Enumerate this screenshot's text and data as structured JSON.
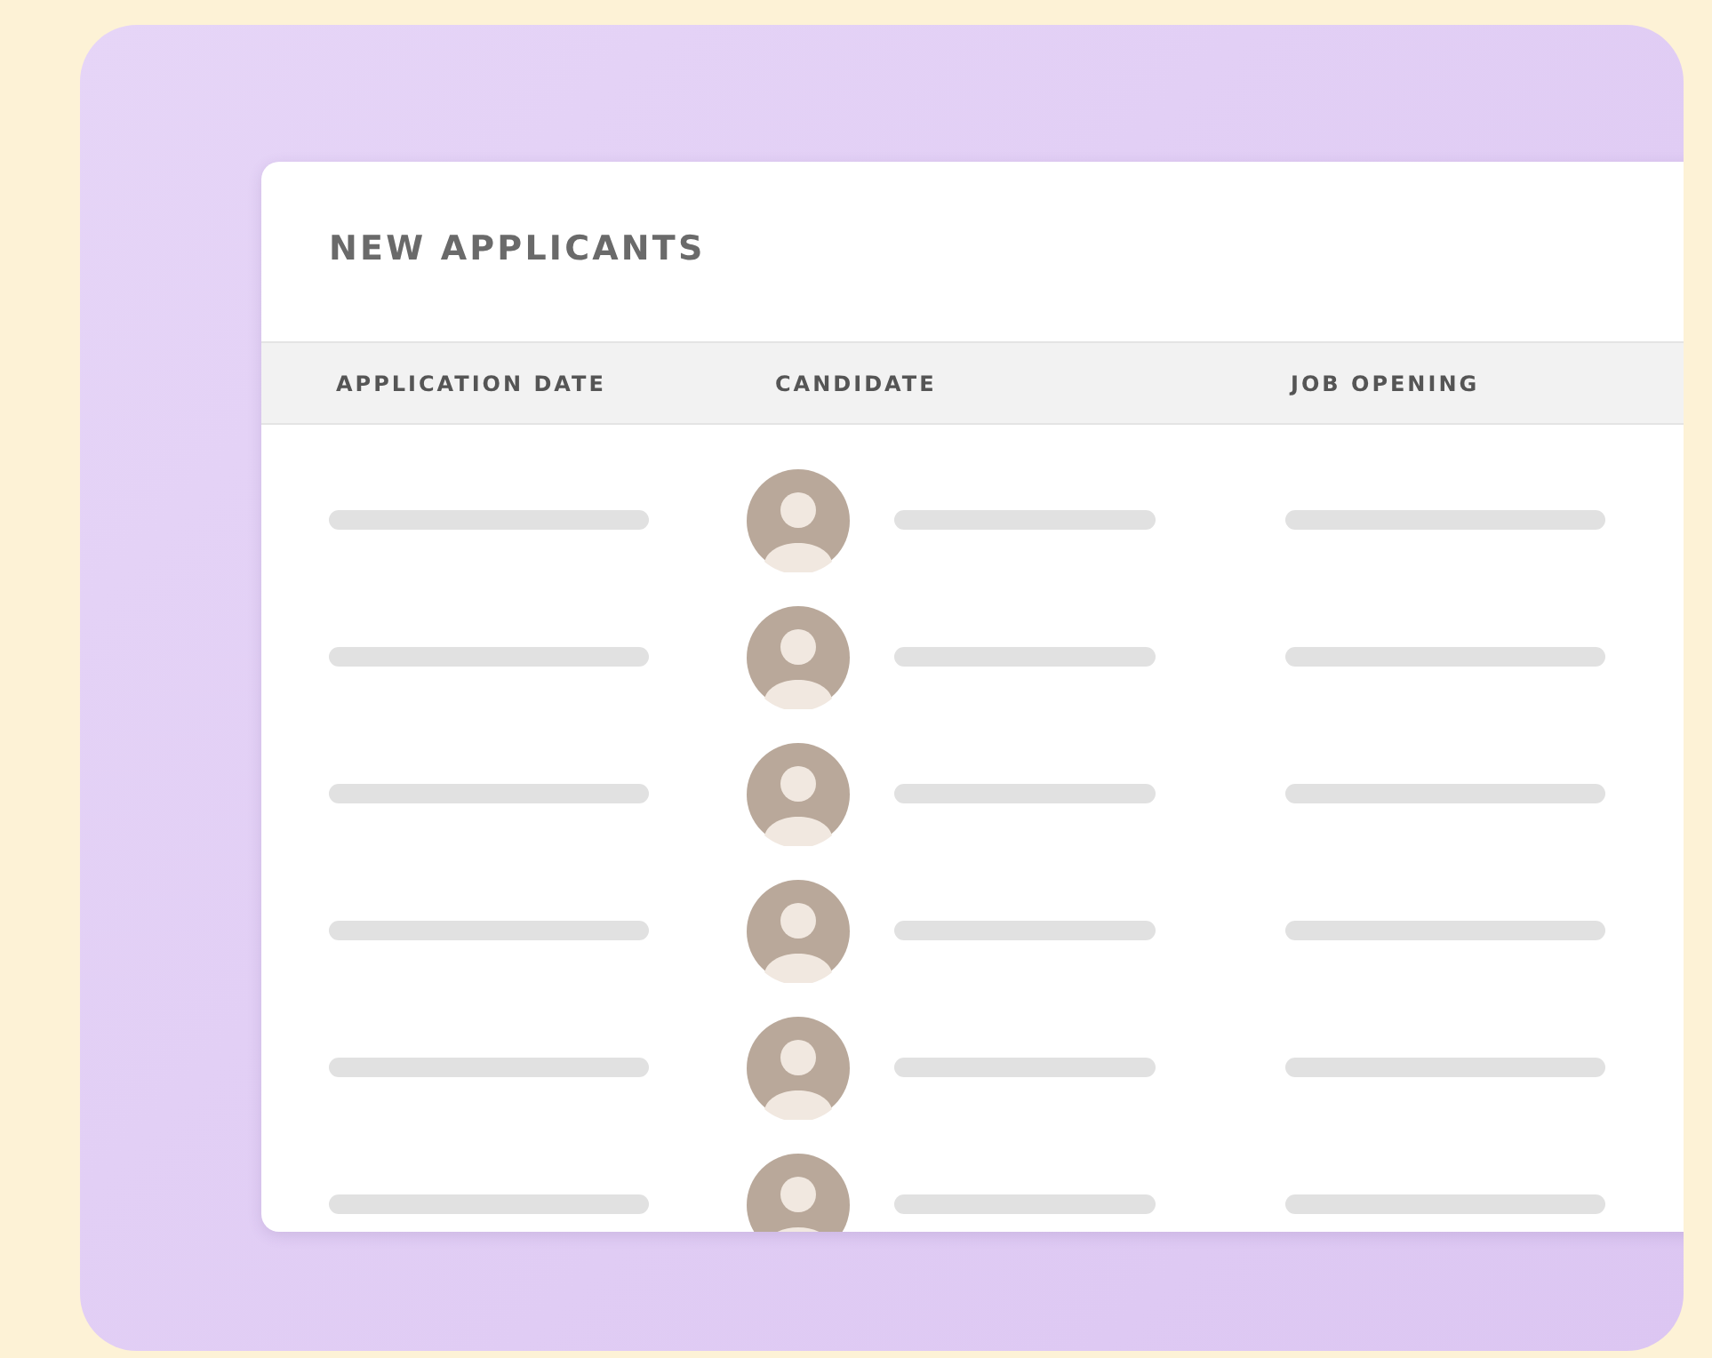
{
  "card": {
    "title": "NEW APPLICANTS"
  },
  "table": {
    "columns": [
      "APPLICATION DATE",
      "CANDIDATE",
      "JOB OPENING"
    ],
    "rows": [
      {
        "kind": "placeholder"
      },
      {
        "kind": "placeholder"
      },
      {
        "kind": "placeholder"
      },
      {
        "kind": "placeholder"
      },
      {
        "kind": "placeholder"
      },
      {
        "kind": "placeholder"
      }
    ]
  }
}
